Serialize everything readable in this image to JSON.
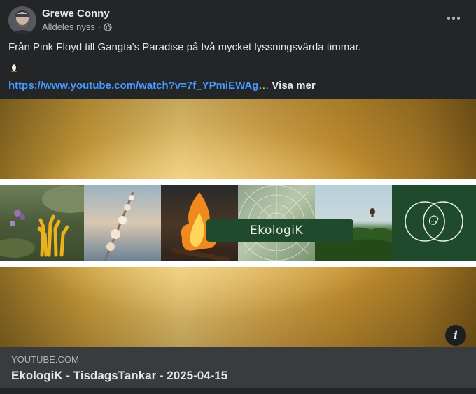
{
  "post": {
    "author": "Grewe Conny",
    "timestamp": "Alldeles nyss",
    "separator": "·",
    "privacy_icon": "globe-icon",
    "menu_icon": "more-horizontal-icon",
    "text": "Från Pink Floyd till Gangta's Paradise på två mycket lyssningsvärda timmar.",
    "emoji_icon": "penguin-icon",
    "link_text": "https://www.youtube.com/watch?v=7f_YPmiEWAg",
    "ellipsis": "…",
    "see_more_label": "Visa mer"
  },
  "media": {
    "banner_text": "EkologiK",
    "info_icon": "info-icon",
    "info_label": "i"
  },
  "preview": {
    "domain": "YOUTUBE.COM",
    "title": "EkologiK - TisdagsTankar - 2025-04-15"
  },
  "colors": {
    "background": "#242526",
    "link": "#4599ff",
    "preview_bg": "#3a3b3c",
    "banner_green": "#1f4a2c"
  }
}
